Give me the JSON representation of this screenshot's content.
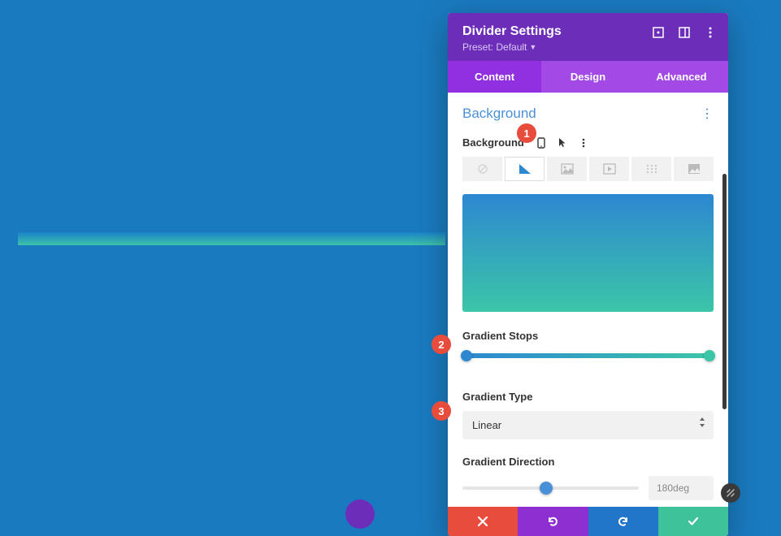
{
  "header": {
    "title": "Divider Settings",
    "preset": "Preset: Default"
  },
  "tabs": {
    "content": "Content",
    "design": "Design",
    "advanced": "Advanced"
  },
  "section": {
    "title": "Background",
    "bg_label": "Background"
  },
  "gradient": {
    "stops_label": "Gradient Stops",
    "type_label": "Gradient Type",
    "type_value": "Linear",
    "direction_label": "Gradient Direction",
    "direction_value": "180deg"
  },
  "callouts": {
    "c1": "1",
    "c2": "2",
    "c3": "3"
  },
  "colors": {
    "gradient_start": "#2d87d1",
    "gradient_end": "#3bc6a8",
    "accent": "#6c2eb9"
  }
}
